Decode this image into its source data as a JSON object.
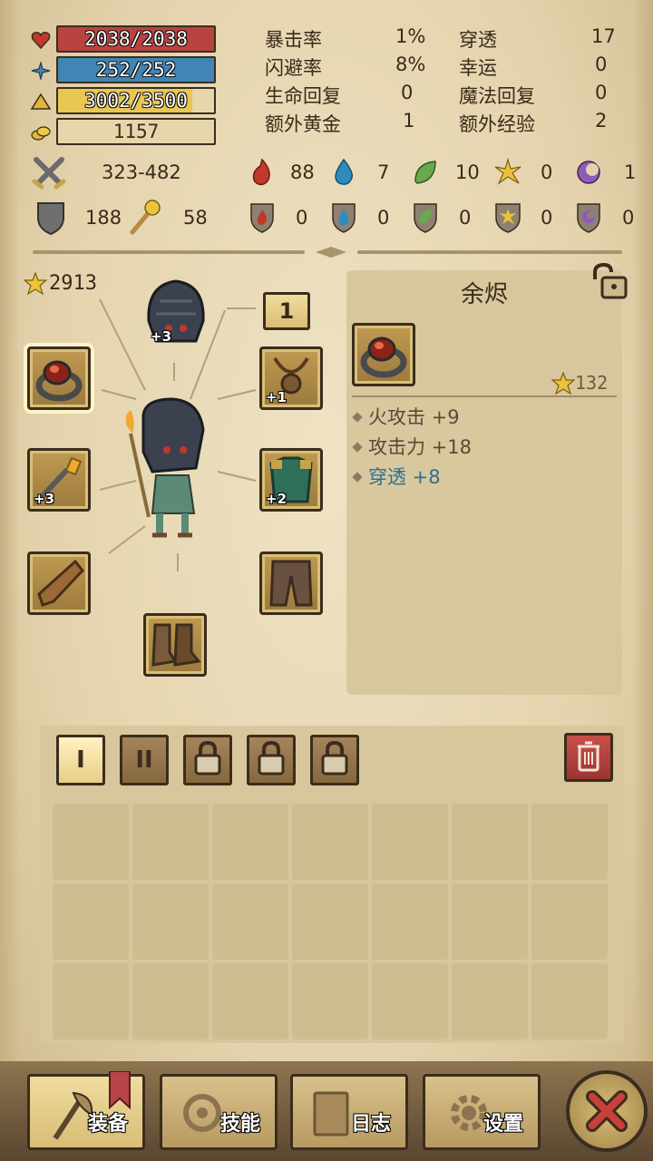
{
  "resources": {
    "hp": "2038/2038",
    "mp": "252/252",
    "exp": "3002/3500",
    "gold": "1157",
    "hp_fill": 1.0,
    "mp_fill": 1.0,
    "exp_fill": 0.858
  },
  "stats": [
    {
      "label": "暴击率",
      "value": "1%",
      "label2": "穿透",
      "value2": "17"
    },
    {
      "label": "闪避率",
      "value": "8%",
      "label2": "幸运",
      "value2": "0"
    },
    {
      "label": "生命回复",
      "value": "0",
      "label2": "魔法回复",
      "value2": "0"
    },
    {
      "label": "额外黄金",
      "value": "1",
      "label2": "额外经验",
      "value2": "2"
    }
  ],
  "attack": {
    "range": "323-482",
    "fire": "88",
    "water": "7",
    "nature": "10",
    "light": "0",
    "dark": "1"
  },
  "defense": {
    "armor": "188",
    "magic_res": "58",
    "fire": "0",
    "water": "0",
    "nature": "0",
    "light": "0",
    "dark": "0"
  },
  "equipment": {
    "power": "2913",
    "helmet_plus": "+3",
    "weapon_plus": "+3",
    "necklace_plus": "+1",
    "armor_plus": "+2",
    "page_indicator": "1"
  },
  "item_detail": {
    "name": "余烬",
    "score": "132",
    "attributes": [
      {
        "text": "火攻击 +9",
        "color": "#5a4936"
      },
      {
        "text": "攻击力 +18",
        "color": "#5a4936"
      },
      {
        "text": "穿透 +8",
        "color": "#2f6f8f"
      }
    ]
  },
  "inventory": {
    "tab1": "I",
    "tab2": "II"
  },
  "nav": {
    "equip": "装备",
    "skills": "技能",
    "log": "日志",
    "settings": "设置"
  },
  "colors": {
    "hp": "#b9433f",
    "mp": "#3f86b5",
    "exp": "#e9c751",
    "gold_bar": "#e6d6ab"
  }
}
